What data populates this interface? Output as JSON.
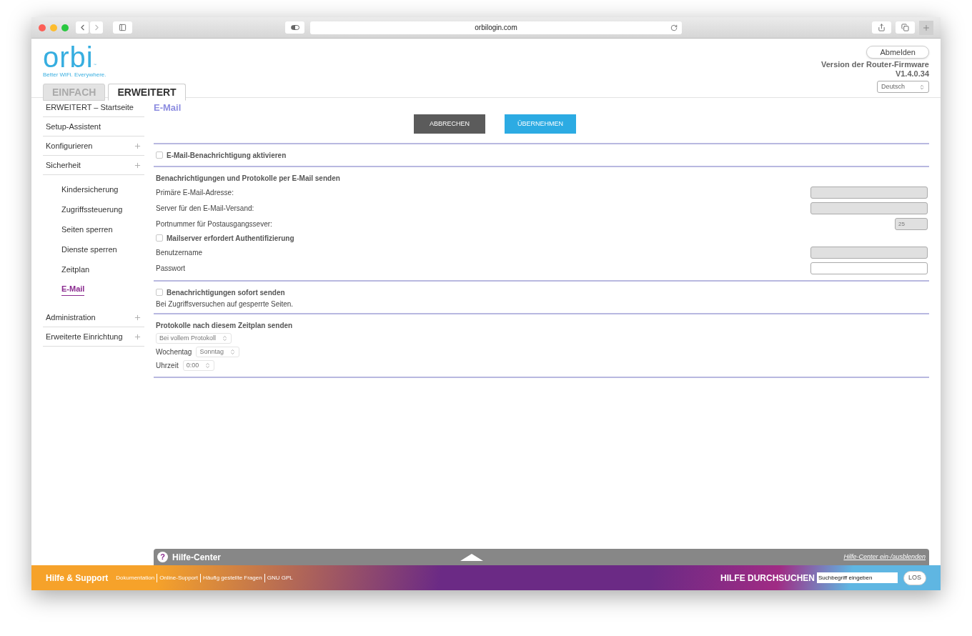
{
  "browser": {
    "url": "orbilogin.com"
  },
  "logo": {
    "text": "orbi",
    "mark": "™",
    "tagline": "Better WiFi. Everywhere."
  },
  "tabs": [
    {
      "label": "EINFACH",
      "selected": false
    },
    {
      "label": "ERWEITERT",
      "selected": true
    }
  ],
  "header": {
    "logout": "Abmelden",
    "firmware_label": "Version der Router-Firmware",
    "firmware_version": "V1.4.0.34",
    "language": "Deutsch"
  },
  "sidebar": {
    "items": [
      {
        "label": "ERWEITERT – Startseite",
        "expandable": false,
        "selected": false
      },
      {
        "label": "Setup-Assistent",
        "expandable": false,
        "selected": false
      },
      {
        "label": "Konfigurieren",
        "expandable": true,
        "selected": false
      },
      {
        "label": "Sicherheit",
        "expandable": true,
        "selected": false,
        "children": [
          {
            "label": "Kindersicherung",
            "selected": false
          },
          {
            "label": "Zugriffssteuerung",
            "selected": false
          },
          {
            "label": "Seiten sperren",
            "selected": false
          },
          {
            "label": "Dienste sperren",
            "selected": false
          },
          {
            "label": "Zeitplan",
            "selected": false
          },
          {
            "label": "E-Mail",
            "selected": true
          }
        ]
      },
      {
        "label": "Administration",
        "expandable": true,
        "selected": false
      },
      {
        "label": "Erweiterte Einrichtung",
        "expandable": true,
        "selected": false
      }
    ]
  },
  "page": {
    "title": "E-Mail",
    "cancel": "ABBRECHEN",
    "apply": "ÜBERNEHMEN"
  },
  "sections": [
    {
      "rows": [
        {
          "kind": "checkbox",
          "label": "E-Mail-Benachrichtigung aktivieren",
          "checked": false
        }
      ]
    },
    {
      "rows": [
        {
          "kind": "heading",
          "label": "Benachrichtigungen und Protokolle per E-Mail senden"
        },
        {
          "kind": "field",
          "label": "Primäre E-Mail-Adresse:",
          "disabled": true
        },
        {
          "kind": "field",
          "label": "Server für den E-Mail-Versand:",
          "disabled": true
        },
        {
          "kind": "small_field",
          "label": "Portnummer für Postausgangssever:",
          "value": "25",
          "disabled": true
        },
        {
          "kind": "checkbox",
          "label": "Mailserver erfordert Authentifizierung",
          "checked": false
        },
        {
          "kind": "field",
          "label": "Benutzername",
          "disabled": true
        },
        {
          "kind": "field",
          "label": "Passwort",
          "disabled": false
        }
      ]
    },
    {
      "rows": [
        {
          "kind": "checkbox",
          "label": "Benachrichtigungen sofort senden",
          "checked": false
        },
        {
          "kind": "text",
          "label": "Bei Zugriffsversuchen auf gesperrte Seiten."
        }
      ]
    },
    {
      "rows": [
        {
          "kind": "heading",
          "label": "Protokolle nach diesem Zeitplan senden"
        },
        {
          "kind": "select",
          "value": "Bei vollem Protokoll"
        },
        {
          "kind": "select",
          "label": "Wochentag",
          "value": "Sonntag"
        },
        {
          "kind": "select",
          "label": "Uhrzeit",
          "value": "0:00"
        }
      ]
    }
  ],
  "help": {
    "icon": "?",
    "title": "Hilfe-Center",
    "toggle": "Hilfe-Center ein-/ausblenden"
  },
  "footer": {
    "title": "Hilfe & Support",
    "links": [
      "Dokumentation",
      "Online-Support",
      "Häufig gestellte Fragen",
      "GNU GPL"
    ],
    "search_label": "HILFE DURCHSUCHEN",
    "search_placeholder": "Suchbegriff eingeben",
    "search_button": "LOS"
  }
}
